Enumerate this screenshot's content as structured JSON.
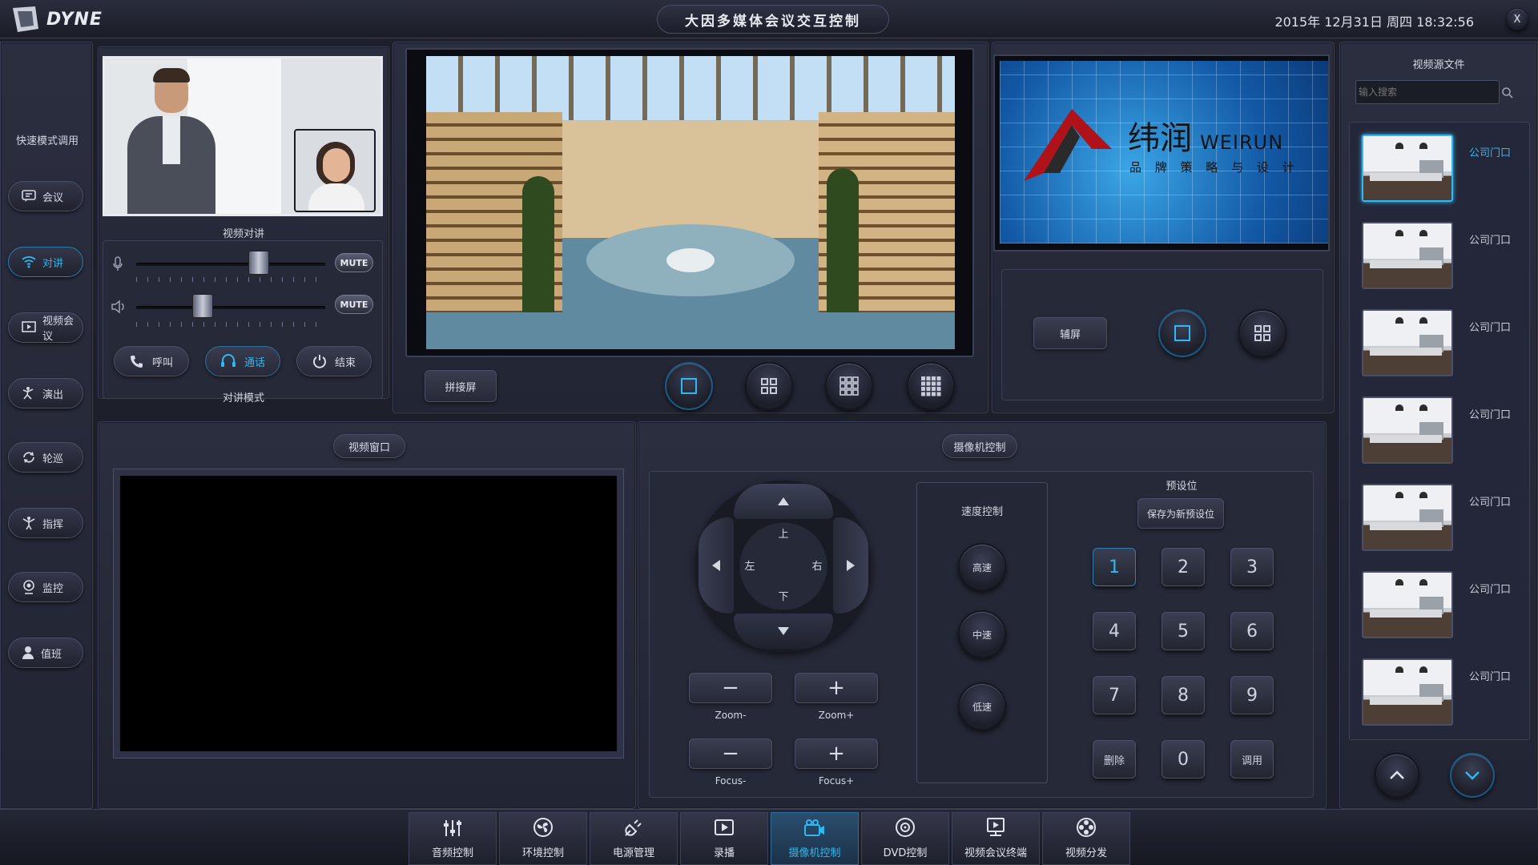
{
  "header": {
    "logo_text": "DYNE",
    "title": "大因多媒体会议交互控制",
    "datetime": "2015年 12月31日 周四 18:32:56",
    "close_label": "X"
  },
  "sidebar": {
    "heading": "快速模式调用",
    "items": [
      {
        "label": "会议",
        "icon": "chat-icon"
      },
      {
        "label": "对讲",
        "icon": "wifi-icon",
        "active": true
      },
      {
        "label": "视频会议",
        "icon": "video-screen-icon"
      },
      {
        "label": "演出",
        "icon": "performer-icon"
      },
      {
        "label": "轮巡",
        "icon": "cycle-icon"
      },
      {
        "label": "指挥",
        "icon": "conductor-icon"
      },
      {
        "label": "监控",
        "icon": "webcam-icon"
      },
      {
        "label": "值班",
        "icon": "person-icon"
      }
    ]
  },
  "intercom": {
    "panel_title": "视频对讲",
    "mic_mute": "MUTE",
    "speaker_mute": "MUTE",
    "mic_level": 0.65,
    "speaker_level": 0.35,
    "call_label": "呼叫",
    "talk_label": "通话",
    "end_label": "结束",
    "mode_label": "对讲模式"
  },
  "main_screen": {
    "splice_label": "拼接屏",
    "layouts": [
      "1x1",
      "2x2",
      "3x3",
      "4x4"
    ],
    "active_layout": "1x1"
  },
  "aux_screen": {
    "aux_label": "辅屏",
    "brand_cn": "纬润",
    "brand_en": "WEIRUN",
    "brand_tagline": "品 牌 策 略 与 设 计",
    "layouts": [
      "1x1",
      "2x2"
    ],
    "active_layout": "1x1"
  },
  "video_window": {
    "title": "视频窗口"
  },
  "camera": {
    "title": "摄像机控制",
    "up": "上",
    "down": "下",
    "left": "左",
    "right": "右",
    "zoom_minus": "Zoom-",
    "zoom_plus": "Zoom+",
    "focus_minus": "Focus-",
    "focus_plus": "Focus+",
    "speed_title": "速度控制",
    "speed_high": "高速",
    "speed_mid": "中速",
    "speed_low": "低速",
    "preset_title": "预设位",
    "save_preset": "保存为新预设位",
    "keys": [
      "1",
      "2",
      "3",
      "4",
      "5",
      "6",
      "7",
      "8",
      "9"
    ],
    "delete_label": "删除",
    "zero_label": "0",
    "recall_label": "调用",
    "selected_key": "1"
  },
  "sources": {
    "title": "视频源文件",
    "search_placeholder": "输入搜索",
    "items": [
      {
        "label": "公司门口",
        "selected": true
      },
      {
        "label": "公司门口"
      },
      {
        "label": "公司门口"
      },
      {
        "label": "公司门口"
      },
      {
        "label": "公司门口"
      },
      {
        "label": "公司门口"
      },
      {
        "label": "公司门口"
      }
    ]
  },
  "bottom_tabs": [
    {
      "label": "音频控制",
      "icon": "sliders-icon"
    },
    {
      "label": "环境控制",
      "icon": "fan-icon"
    },
    {
      "label": "电源管理",
      "icon": "plug-icon"
    },
    {
      "label": "录播",
      "icon": "play-icon"
    },
    {
      "label": "摄像机控制",
      "icon": "camera-icon",
      "active": true
    },
    {
      "label": "DVD控制",
      "icon": "disc-icon"
    },
    {
      "label": "视频会议终端",
      "icon": "terminal-icon"
    },
    {
      "label": "视频分发",
      "icon": "film-reel-icon"
    }
  ],
  "colors": {
    "accent": "#2fb8f2",
    "background": "#1d1f2b",
    "panel": "#262938"
  }
}
